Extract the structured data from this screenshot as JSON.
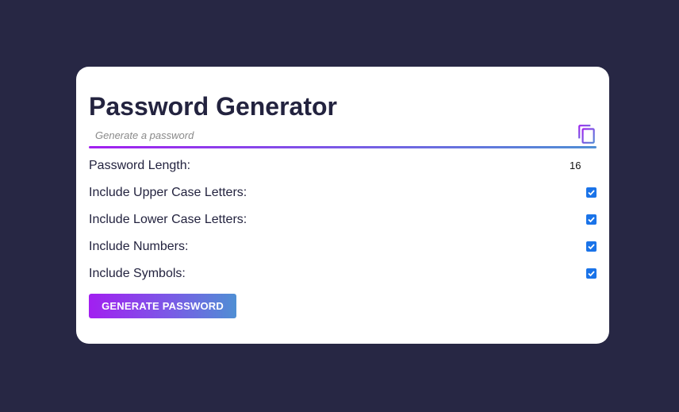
{
  "title": "Password Generator",
  "password": {
    "placeholder": "Generate a password",
    "value": "",
    "copy_icon": "copy-icon"
  },
  "options": {
    "length_label": "Password Length:",
    "length_value": "16",
    "uppercase_label": "Include Upper Case Letters:",
    "uppercase_checked": true,
    "lowercase_label": "Include Lower Case Letters:",
    "lowercase_checked": true,
    "numbers_label": "Include Numbers:",
    "numbers_checked": true,
    "symbols_label": "Include Symbols:",
    "symbols_checked": true
  },
  "generate_button": "GENERATE PASSWORD",
  "colors": {
    "background": "#272744",
    "card": "#ffffff",
    "accent_start": "#a21ff0",
    "accent_end": "#4f8fd4",
    "checkbox": "#1a73e8",
    "text": "#23233f"
  }
}
